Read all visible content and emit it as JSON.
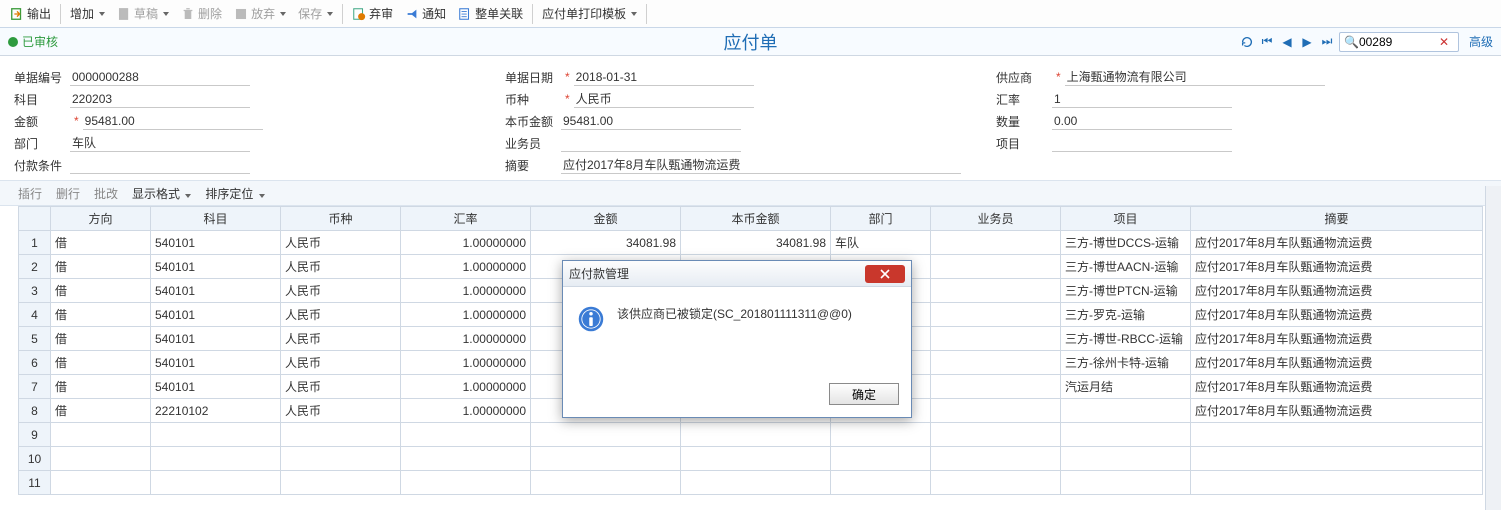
{
  "toolbar": {
    "output": "输出",
    "add": "增加",
    "draft": "草稿",
    "delete": "删除",
    "abandon": "放弃",
    "save": "保存",
    "discard": "弃审",
    "notify": "通知",
    "link": "整单关联",
    "print_tpl": "应付单打印模板"
  },
  "status": {
    "approved": "已审核"
  },
  "doc_title": "应付单",
  "nav": {
    "search_value": "00289",
    "advanced": "高级"
  },
  "form": {
    "bill_no_label": "单据编号",
    "bill_no": "0000000288",
    "subject_label": "科目",
    "subject": "220203",
    "amount_label": "金额",
    "amount": "95481.00",
    "dept_label": "部门",
    "dept": "车队",
    "pay_terms_label": "付款条件",
    "pay_terms": "",
    "bill_date_label": "单据日期",
    "bill_date": "2018-01-31",
    "currency_label": "币种",
    "currency": "人民币",
    "local_amount_label": "本币金额",
    "local_amount": "95481.00",
    "operator_label": "业务员",
    "operator": "",
    "summary_label": "摘要",
    "summary": "应付2017年8月车队甄通物流运费",
    "supplier_label": "供应商",
    "supplier": "上海甄通物流有限公司",
    "rate_label": "汇率",
    "rate": "1",
    "qty_label": "数量",
    "qty": "0.00",
    "project_label": "项目",
    "project": ""
  },
  "tbl_toolbar": {
    "ins_row": "插行",
    "del_row": "删行",
    "batch": "批改",
    "display_fmt": "显示格式",
    "sort": "排序定位"
  },
  "columns": [
    "",
    "方向",
    "科目",
    "币种",
    "汇率",
    "金额",
    "本币金额",
    "部门",
    "业务员",
    "项目",
    "摘要"
  ],
  "rows": [
    {
      "n": "1",
      "dir": "借",
      "subj": "540101",
      "cur": "人民币",
      "rate": "1.00000000",
      "amt": "34081.98",
      "lamt": "34081.98",
      "dept": "车队",
      "op": "",
      "proj": "三方-博世DCCS-运输",
      "sum": "应付2017年8月车队甄通物流运费"
    },
    {
      "n": "2",
      "dir": "借",
      "subj": "540101",
      "cur": "人民币",
      "rate": "1.00000000",
      "amt": "",
      "lamt": "",
      "dept": "",
      "op": "",
      "proj": "三方-博世AACN-运输",
      "sum": "应付2017年8月车队甄通物流运费"
    },
    {
      "n": "3",
      "dir": "借",
      "subj": "540101",
      "cur": "人民币",
      "rate": "1.00000000",
      "amt": "",
      "lamt": "",
      "dept": "",
      "op": "",
      "proj": "三方-博世PTCN-运输",
      "sum": "应付2017年8月车队甄通物流运费"
    },
    {
      "n": "4",
      "dir": "借",
      "subj": "540101",
      "cur": "人民币",
      "rate": "1.00000000",
      "amt": "",
      "lamt": "",
      "dept": "",
      "op": "",
      "proj": "三方-罗克-运输",
      "sum": "应付2017年8月车队甄通物流运费"
    },
    {
      "n": "5",
      "dir": "借",
      "subj": "540101",
      "cur": "人民币",
      "rate": "1.00000000",
      "amt": "",
      "lamt": "",
      "dept": "",
      "op": "",
      "proj": "三方-博世-RBCC-运输",
      "sum": "应付2017年8月车队甄通物流运费"
    },
    {
      "n": "6",
      "dir": "借",
      "subj": "540101",
      "cur": "人民币",
      "rate": "1.00000000",
      "amt": "",
      "lamt": "",
      "dept": "",
      "op": "",
      "proj": "三方-徐州卡特-运输",
      "sum": "应付2017年8月车队甄通物流运费"
    },
    {
      "n": "7",
      "dir": "借",
      "subj": "540101",
      "cur": "人民币",
      "rate": "1.00000000",
      "amt": "",
      "lamt": "",
      "dept": "",
      "op": "",
      "proj": "汽运月结",
      "sum": "应付2017年8月车队甄通物流运费"
    },
    {
      "n": "8",
      "dir": "借",
      "subj": "22210102",
      "cur": "人民币",
      "rate": "1.00000000",
      "amt": "",
      "lamt": "",
      "dept": "",
      "op": "",
      "proj": "",
      "sum": "应付2017年8月车队甄通物流运费"
    },
    {
      "n": "9",
      "dir": "",
      "subj": "",
      "cur": "",
      "rate": "",
      "amt": "",
      "lamt": "",
      "dept": "",
      "op": "",
      "proj": "",
      "sum": ""
    },
    {
      "n": "10",
      "dir": "",
      "subj": "",
      "cur": "",
      "rate": "",
      "amt": "",
      "lamt": "",
      "dept": "",
      "op": "",
      "proj": "",
      "sum": ""
    },
    {
      "n": "11",
      "dir": "",
      "subj": "",
      "cur": "",
      "rate": "",
      "amt": "",
      "lamt": "",
      "dept": "",
      "op": "",
      "proj": "",
      "sum": ""
    }
  ],
  "dialog": {
    "title": "应付款管理",
    "message": "该供应商已被锁定(SC_201801111311@@0)",
    "ok": "确定"
  }
}
